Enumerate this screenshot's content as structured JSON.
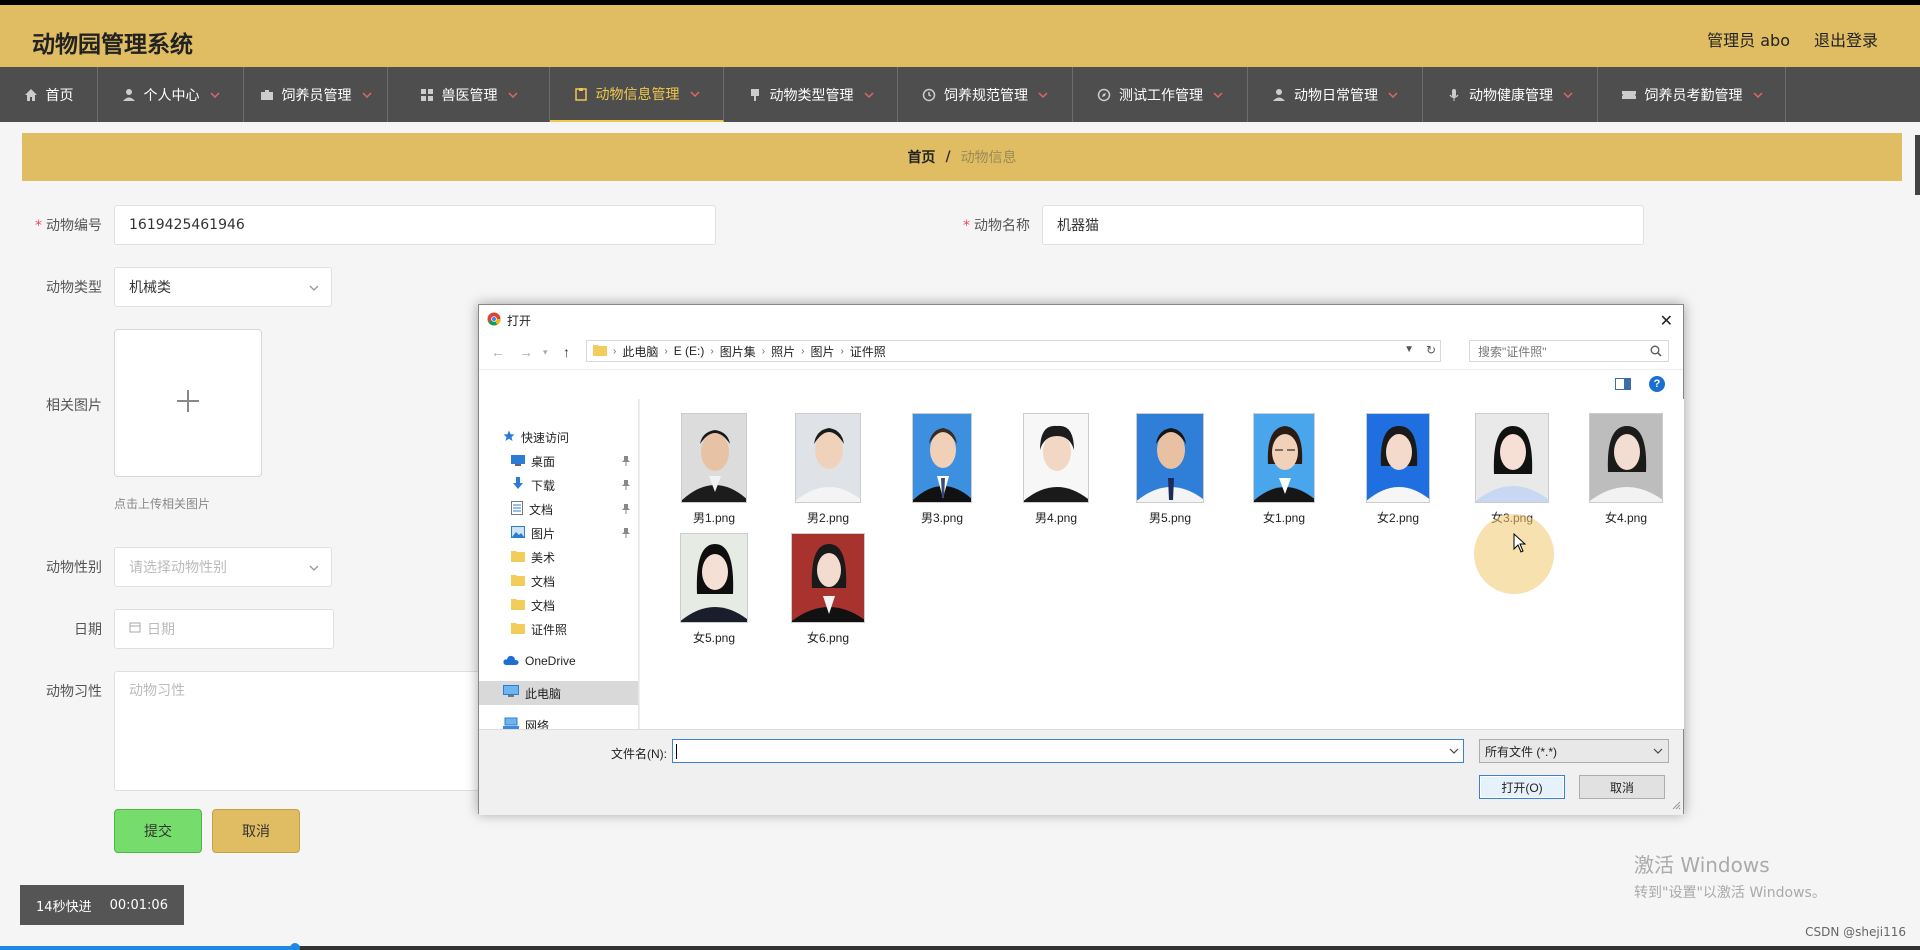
{
  "header": {
    "title": "动物园管理系统",
    "admin": "管理员 abo",
    "logout": "退出登录"
  },
  "nav": [
    {
      "label": "首页",
      "icon": "home-icon"
    },
    {
      "label": "个人中心",
      "icon": "user-icon"
    },
    {
      "label": "饲养员管理",
      "icon": "briefcase-icon"
    },
    {
      "label": "兽医管理",
      "icon": "grid-icon"
    },
    {
      "label": "动物信息管理",
      "icon": "clipboard-icon"
    },
    {
      "label": "动物类型管理",
      "icon": "marker-icon"
    },
    {
      "label": "饲养规范管理",
      "icon": "clock-icon"
    },
    {
      "label": "测试工作管理",
      "icon": "compass-icon"
    },
    {
      "label": "动物日常管理",
      "icon": "user-icon"
    },
    {
      "label": "动物健康管理",
      "icon": "microphone-icon"
    },
    {
      "label": "饲养员考勤管理",
      "icon": "ticket-icon"
    }
  ],
  "breadcrumb": {
    "home": "首页",
    "sep": "/",
    "current": "动物信息"
  },
  "form": {
    "animal_id": {
      "label": "动物编号",
      "value": "1619425461946"
    },
    "animal_name": {
      "label": "动物名称",
      "value": "机器猫"
    },
    "animal_type": {
      "label": "动物类型",
      "value": "机械类"
    },
    "photo": {
      "label": "相关图片",
      "hint": "点击上传相关图片"
    },
    "gender": {
      "label": "动物性别",
      "placeholder": "请选择动物性别"
    },
    "date": {
      "label": "日期",
      "placeholder": "日期"
    },
    "habit": {
      "label": "动物习性",
      "placeholder": "动物习性"
    },
    "submit": "提交",
    "cancel": "取消"
  },
  "dialog": {
    "title": "打开",
    "path": [
      "此电脑",
      "E (E:)",
      "图片集",
      "照片",
      "图片",
      "证件照"
    ],
    "search_placeholder": "搜索\"证件照\"",
    "sidebar": {
      "quick_access": "快速访问",
      "quick_items": [
        "桌面",
        "下载",
        "文档",
        "图片",
        "美术",
        "文档",
        "文档",
        "证件照"
      ],
      "onedrive": "OneDrive",
      "this_pc": "此电脑",
      "network": "网络"
    },
    "files": [
      "男1.png",
      "男2.png",
      "男3.png",
      "男4.png",
      "男5.png",
      "女1.png",
      "女2.png",
      "女3.png",
      "女4.png",
      "女5.png",
      "女6.png"
    ],
    "filename_label": "文件名(N):",
    "filter": "所有文件 (*.*)",
    "open": "打开(O)",
    "cancel": "取消"
  },
  "overlay": {
    "speed": "14秒快进",
    "time": "00:01:06",
    "win_line1": "激活 Windows",
    "win_line2": "转到\"设置\"以激活 Windows。",
    "csdn": "CSDN @sheji116"
  },
  "colors": {
    "accent": "#e0bd63",
    "nav_bg": "#4e4e4e",
    "submit": "#76dc6b",
    "active_nav": "#f0c74f"
  }
}
